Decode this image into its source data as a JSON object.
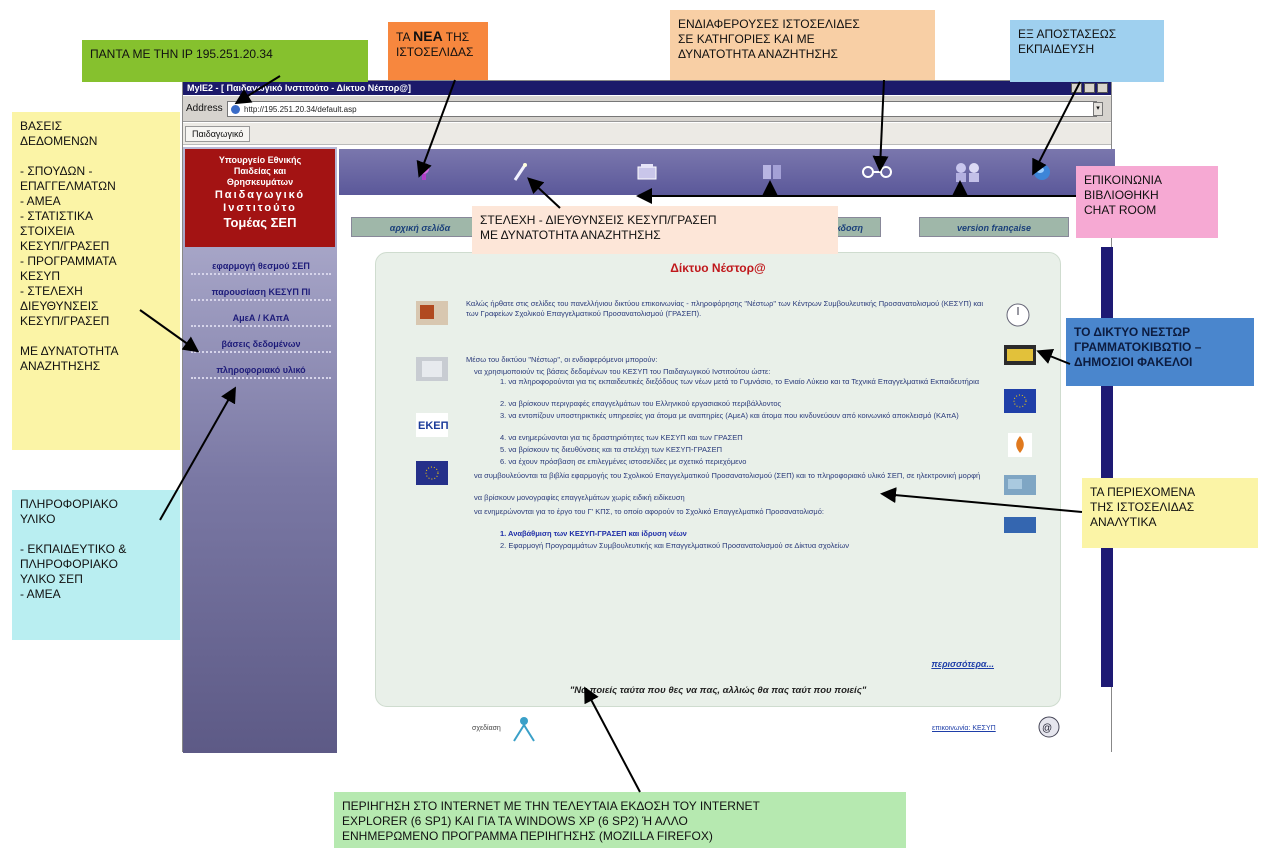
{
  "callouts": {
    "ip": "ΠΑΝΤΑ ΜΕ ΤΗΝ  IP 195.251.20.34",
    "news_pre": "ΤΑ ",
    "news_bold": "ΝΕΑ",
    "news_post": " ΤΗΣ\nΙΣΤΟΣΕΛΙΔΑΣ",
    "sites": "ΕΝΔΙΑΦΕΡΟΥΣΕΣ ΙΣΤΟΣΕΛΙΔΕΣ\nΣΕ ΚΑΤΗΓΟΡΙΕΣ ΚΑΙ ΜΕ\nΔΥΝΑΤΟΤΗΤΑ ΑΝΑΖΗΤΗΣΗΣ",
    "distance": "ΕΞ ΑΠΟΣΤΑΣΕΩΣ\nΕΚΠΑΙΔΕΥΣΗ",
    "databases": "ΒΑΣΕΙΣ\nΔΕΔΟΜΕΝΩΝ\n\n- ΣΠΟΥΔΩΝ -\nΕΠΑΓΓΕΛΜΑΤΩΝ\n- ΑΜΕΑ\n- ΣΤΑΤΙΣΤΙΚΑ\nΣΤΟΙΧΕΙΑ\nΚΕΣΥΠ/ΓΡΑΣΕΠ\n- ΠΡΟΓΡΑΜΜΑΤΑ\nΚΕΣΥΠ\n- ΣΤΕΛΕΧΗ\nΔΙΕΥΘΥΝΣΕΙΣ\nΚΕΣΥΠ/ΓΡΑΣΕΠ\n\nΜΕ ΔΥΝΑΤΟΤΗΤΑ\nΑΝΑΖΗΤΗΣΗΣ",
    "contact": "ΕΠΙΚΟΙΝΩΝΙΑ\nΒΙΒΛΙΟΘΗΚΗ\nCHAT ROOM",
    "staff": "ΣΤΕΛΕΧΗ -  ΔΙΕΥΘΥΝΣΕΙΣ ΚΕΣΥΠ/ΓΡΑΣΕΠ\nΜΕ ΔΥΝΑΤΟΤΗΤΑ ΑΝΑΖΗΤΗΣΗΣ",
    "nestor_net": "ΤΟ ΔΙΚΤΥΟ ΝΕΣΤΩΡ\nΓΡΑΜΜΑΤΟΚΙΒΩΤΙΟ –\nΔΗΜΟΣΙΟΙ ΦΑΚΕΛΟΙ",
    "info_material": "ΠΛΗΡΟΦΟΡΙΑΚΟ\nΥΛΙΚΟ\n\n- ΕΚΠΑΙΔΕΥΤΙΚΟ  &\nΠΛΗΡΟΦΟΡΙΑΚΟ\nΥΛΙΚΟ ΣΕΠ\n- ΑΜΕΑ",
    "contents": "ΤΑ ΠΕΡΙΕΧΟΜΕΝΑ\nΤΗΣ ΙΣΤΟΣΕΛΙΔΑΣ\nΑΝΑΛΥΤΙΚΑ",
    "browsing": "ΠΕΡΙΗΓΗΣΗ ΣΤΟ INTERNET ΜΕ ΤΗΝ ΤΕΛΕΥΤΑΙΑ ΕΚΔΟΣΗ ΤΟΥ INTERNET\nEXPLORER (6 SP1) ΚΑΙ ΓΙΑ ΤΑ WINDOWS XP (6 SP2) Ή ΑΛΛΟ\nΕΝΗΜΕΡΩΜΕΝΟ ΠΡΟΓΡΑΜΜΑ ΠΕΡΙΗΓΗΣΗΣ (MOZILLA FIREFOX)"
  },
  "browser": {
    "title": "MyIE2 - [ Παιδαγωγικό Ινστιτούτο - Δίκτυο Νέστορ@]",
    "address_label": "Address",
    "url": "http://195.251.20.34/default.asp",
    "tab": "Παιδαγωγικό"
  },
  "site": {
    "ministry_1": "Υπουργείο Εθνικής",
    "ministry_2": "Παιδείας και",
    "ministry_3": "Θρησκευμάτων",
    "institute": "Παιδαγωγικό",
    "institute_2": "Ινστιτούτο",
    "sector": "Τομέας ΣΕΠ",
    "nav": [
      "εφαρμογή θεσμού ΣΕΠ",
      "παρουσίαση ΚΕΣΥΠ ΠΙ",
      "ΑμεΑ / ΚΑπΑ",
      "βάσεις δεδομένων",
      "πληροφοριακό υλικό"
    ],
    "navbtn_home": "αρχική σελίδα",
    "navbtn_mid": "ελληνική έκδοση",
    "navbtn_fr": "version française",
    "content_title": "Δίκτυο Νέστορ@",
    "intro": "Καλώς ήρθατε στις σελίδες του πανελλήνιου δικτύου επικοινωνίας - πληροφόρησης \"Νέστωρ\" των Κέντρων Συμβουλευτικής Προσανατολισμού (ΚΕΣΥΠ) και των Γραφείων Σχολικού Επαγγελματικού Προσανατολισμού (ΓΡΑΣΕΠ).",
    "lead": "Μέσω του δικτύου \"Νέστωρ\", οι ενδιαφερόμενοι μπορούν:",
    "bullets": [
      "να χρησιμοποιούν τις βάσεις δεδομένων του ΚΕΣΥΠ του Παιδαγωγικού Ινστιτούτου ώστε:",
      "1.  να πληροφορούνται για τις εκπαιδευτικές διεξόδους των νέων μετά το Γυμνάσιο, το Ενιαίο Λύκειο και τα Τεχνικά Επαγγελματικά Εκπαιδευτήρια",
      "2.  να βρίσκουν περιγραφές επαγγελμάτων του Ελληνικού εργασιακού περιβάλλοντος",
      "3.  να εντοπίζουν υποστηρικτικές υπηρεσίες για άτομα με αναπηρίες (ΑμεΑ) και άτομα που κινδυνεύουν από κοινωνικό αποκλεισμό (ΚΑπΑ)",
      "4.  να ενημερώνονται για τις δραστηριότητες των ΚΕΣΥΠ και των ΓΡΑΣΕΠ",
      "5.  να βρίσκουν τις διευθύνσεις και τα στελέχη των ΚΕΣΥΠ-ΓΡΑΣΕΠ",
      "6.  να έχουν πρόσβαση σε επιλεγμένες ιστοσελίδες με σχετικό περιεχόμενο",
      "να συμβουλεύονται τα βιβλία εφαρμογής του Σχολικού Επαγγελματικού Προσανατολισμού (ΣΕΠ) και το πληροφοριακό υλικό ΣΕΠ, σε ηλεκτρονική μορφή",
      "να βρίσκουν μονογραφίες επαγγελμάτων χωρίς ειδική ειδίκευση",
      "να ενημερώνονται για το έργο του Γ' ΚΠΣ, το οποίο αφορούν το Σχολικό Επαγγελματικό Προσανατολισμό:",
      "1.  Αναβάθμιση των ΚΕΣΥΠ-ΓΡΑΣΕΠ και ίδρυση νέων",
      "2.  Εφαρμογή Προγραμμάτων Συμβουλευτικής και Επαγγελματικού Προσανατολισμού σε Δίκτυα σχολείων"
    ],
    "more": "περισσότερα...",
    "quote": "\"Να ποιείς ταύτα που θες να πας, αλλιώς θα πας ταύτ που ποιείς\"",
    "footer_left": "σχεδίαση",
    "footer_right": "επικοινωνία: ΚΕΣΥΠ"
  },
  "colors": {
    "ip_bg": "#86c12e",
    "news_bg": "#f7873e",
    "sites_bg": "#f8cfa5",
    "distance_bg": "#9fd0ef",
    "databases_bg": "#fbf4a6",
    "contact_bg": "#f6a9d3",
    "staff_bg": "#fde6d8",
    "nestor_bg": "#4a86cd",
    "info_bg": "#b9eef1",
    "contents_bg": "#fbf4a6",
    "browsing_bg": "#b6e9b0"
  }
}
